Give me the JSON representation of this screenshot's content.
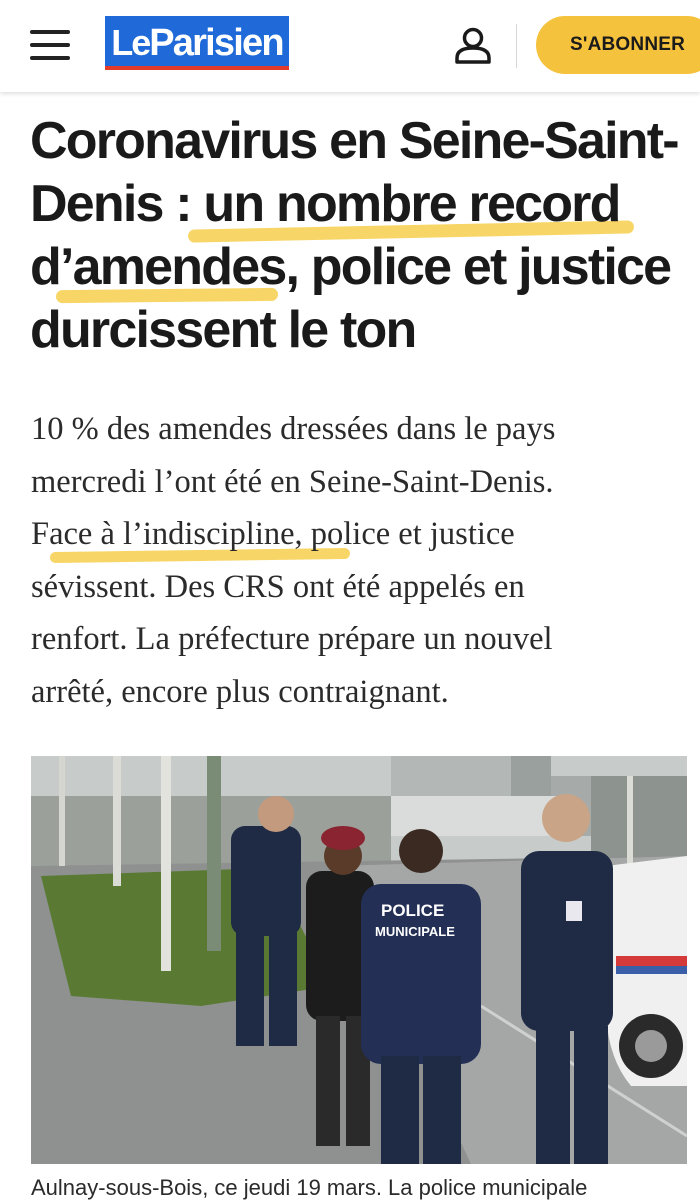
{
  "header": {
    "logo_text_le": "Le",
    "logo_text_parisien": "Parisien",
    "subscribe_label": "S'ABONNER",
    "icons": [
      "hamburger-menu-icon",
      "user-account-icon"
    ],
    "colors": {
      "logo_blue": "#1f6ad8",
      "logo_red": "#e23b2a",
      "subscribe_yellow": "#f5c23d"
    }
  },
  "article": {
    "headline": {
      "line1": "Coronavirus en Seine-Saint-",
      "line2": "Denis : un nombre record",
      "line3": "d’amendes, police et justice",
      "line4": "durcissent le ton"
    },
    "lead": {
      "line1": "10 % des amendes dressées dans le pays",
      "line2": "mercredi l’ont été en Seine-Saint-Denis.",
      "line3": "Face à l’indiscipline, police et justice",
      "line4": "sévissent. Des CRS ont été appelés en",
      "line5": "renfort. La préfecture prépare un nouvel",
      "line6": "arrêté, encore plus contraignant."
    },
    "photo": {
      "vest_text_1": "POLICE",
      "vest_text_2": "MUNICIPALE"
    },
    "caption": "Aulnay-sous-Bois, ce jeudi 19 mars. La police municipale",
    "highlight_color": "#f6d256"
  }
}
